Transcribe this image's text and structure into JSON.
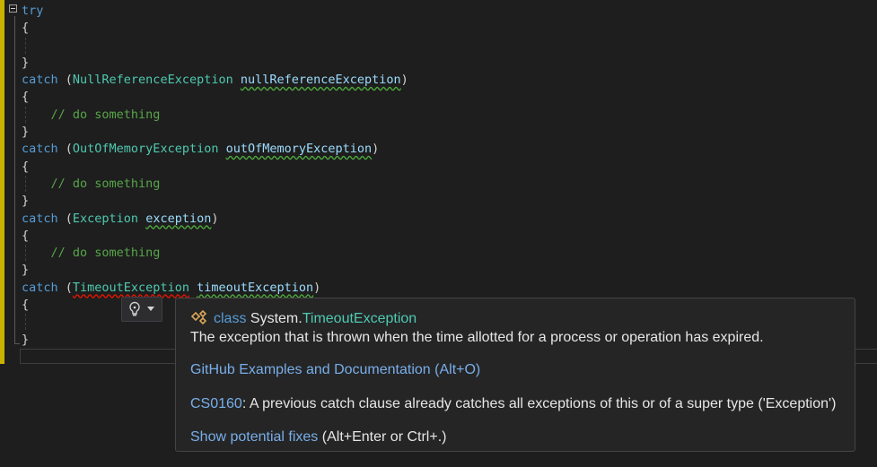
{
  "code": {
    "lines": [
      {
        "kw": "try"
      },
      {
        "punct": "{"
      },
      {
        "punct": ""
      },
      {
        "punct": "}"
      },
      {
        "kw": "catch",
        "open": " (",
        "type": "NullReferenceException",
        "sp": " ",
        "ident": "nullReferenceException",
        "close": ")"
      },
      {
        "punct": "{"
      },
      {
        "comment": "// do something"
      },
      {
        "punct": "}"
      },
      {
        "kw": "catch",
        "open": " (",
        "type": "OutOfMemoryException",
        "sp": " ",
        "ident": "outOfMemoryException",
        "close": ")"
      },
      {
        "punct": "{"
      },
      {
        "comment": "// do something"
      },
      {
        "punct": "}"
      },
      {
        "kw": "catch",
        "open": " (",
        "type": "Exception",
        "sp": " ",
        "ident": "exception",
        "close": ")"
      },
      {
        "punct": "{"
      },
      {
        "comment": "// do something"
      },
      {
        "punct": "}"
      },
      {
        "kw": "catch",
        "open": " (",
        "type": "TimeoutException",
        "sp": " ",
        "ident": "timeoutException",
        "close": ")"
      },
      {
        "punct": "{"
      },
      {
        "punct": ""
      },
      {
        "punct": "}"
      }
    ]
  },
  "quick_actions": {
    "icon": "lightbulb-icon",
    "dropdown_icon": "caret-down-icon"
  },
  "tooltip": {
    "class_keyword": "class",
    "namespace": "System.",
    "type_name": "TimeoutException",
    "description": "The exception that is thrown when the time allotted for a process or operation has expired.",
    "github_link": "GitHub Examples and Documentation (Alt+O)",
    "error_code": "CS0160",
    "error_message": ": A previous catch clause already catches all exceptions of this or of a super type ('Exception')",
    "fix_link": "Show potential fixes",
    "fix_shortcut": " (Alt+Enter or Ctrl+.)"
  },
  "colors": {
    "background": "#1e1e1e",
    "keyword": "#569cd6",
    "type": "#4ec9b0",
    "identifier": "#9cdcfe",
    "comment": "#57a64a",
    "link": "#78aee8",
    "change_margin": "#c9b100"
  }
}
